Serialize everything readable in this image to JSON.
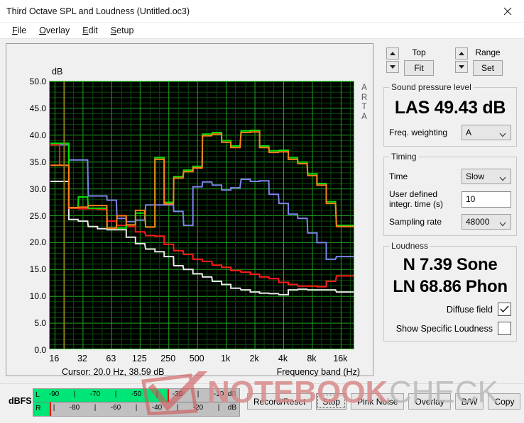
{
  "window": {
    "title": "Third Octave SPL and Loudness (Untitled.oc3)",
    "close_icon": "close-icon"
  },
  "menu": [
    {
      "pre": "F",
      "rest": "ile"
    },
    {
      "pre": "O",
      "rest": "verlay"
    },
    {
      "pre": "E",
      "rest": "dit"
    },
    {
      "pre": "S",
      "rest": "etup"
    }
  ],
  "chart_panel": {
    "title": "Third octave SPL",
    "y_unit": "dB",
    "x_label": "Frequency band (Hz)",
    "cursor": "Cursor:   20.0 Hz, 38.59 dB",
    "watermark_text": "ARTA"
  },
  "controls": {
    "top_label": "Top",
    "top_button": "Fit",
    "range_label": "Range",
    "range_button": "Set",
    "spl_group": "Sound pressure level",
    "spl_value": "LAS 49.43 dB",
    "weighting_label": "Freq. weighting",
    "weighting_value": "A",
    "timing_group": "Timing",
    "time_label": "Time",
    "time_value": "Slow",
    "integr_label_1": "User defined",
    "integr_label_2": "integr. time (s)",
    "integr_value": "10",
    "sampling_label": "Sampling rate",
    "sampling_value": "48000",
    "loudness_group": "Loudness",
    "loudness_sone": "N 7.39 Sone",
    "loudness_phon": "LN 68.86 Phon",
    "diffuse_label": "Diffuse field",
    "diffuse_checked": true,
    "specific_label": "Show Specific Loudness",
    "specific_checked": false
  },
  "meters": {
    "title": "dBFS",
    "left_channel": "L",
    "right_channel": "R",
    "unit": "dB",
    "left_ticks": [
      "-90",
      "-70",
      "-50",
      "-30",
      "-10"
    ],
    "right_ticks": [
      "-80",
      "-60",
      "-40",
      "-20"
    ],
    "left_level_pct": 65,
    "right_level_pct": 8,
    "bar_color": "#00e676",
    "peak_color": "#ff0000"
  },
  "buttons": [
    {
      "label": "Record/Reset",
      "focused": false
    },
    {
      "label": "Stop",
      "focused": true
    },
    {
      "label": "Pink Noise",
      "focused": false
    },
    {
      "label": "Overlay",
      "focused": false
    },
    {
      "label": "B/W",
      "focused": false
    },
    {
      "label": "Copy",
      "focused": false
    }
  ],
  "watermark": {
    "text_bold": "NOTEBOOK",
    "text_light": "CHECK"
  },
  "chart_data": {
    "type": "line",
    "title": "Third octave SPL",
    "xlabel": "Frequency band (Hz)",
    "ylabel": "dB",
    "ylim": [
      0.0,
      50.0
    ],
    "ytick_step": 5.0,
    "yticks": [
      "50.0",
      "45.0",
      "40.0",
      "35.0",
      "30.0",
      "25.0",
      "20.0",
      "15.0",
      "10.0",
      "5.0",
      "0.0"
    ],
    "xticks": [
      "16",
      "32",
      "63",
      "125",
      "250",
      "500",
      "1k",
      "2k",
      "4k",
      "8k",
      "16k"
    ],
    "x_log_scale": true,
    "grid": true,
    "step_plot": true,
    "cursor_freq_hz": 20.0,
    "cursor_db": 38.59,
    "bands_hz": [
      16,
      20,
      25,
      31.5,
      40,
      50,
      63,
      80,
      100,
      125,
      160,
      200,
      250,
      315,
      400,
      500,
      630,
      800,
      1000,
      1250,
      1600,
      2000,
      2500,
      3150,
      4000,
      5000,
      6300,
      8000,
      10000,
      12500,
      16000,
      20000
    ],
    "series": [
      {
        "name": "green",
        "color": "#00e000",
        "values": [
          38.5,
          38.5,
          26.5,
          28.5,
          26.4,
          26.4,
          22.7,
          22.7,
          23.3,
          25.5,
          22.9,
          35.8,
          27.5,
          32.3,
          33.5,
          34.2,
          40.2,
          40.5,
          39.0,
          38.0,
          40.8,
          40.9,
          38.0,
          37.1,
          37.2,
          35.8,
          35.0,
          32.8,
          31.0,
          27.6,
          23.2,
          23.2
        ]
      },
      {
        "name": "orange",
        "color": "#ff7f1a",
        "values": [
          34.4,
          34.4,
          26.5,
          26.6,
          26.9,
          26.9,
          22.7,
          25.0,
          23.3,
          26.0,
          22.9,
          35.5,
          27.2,
          32.0,
          33.2,
          33.9,
          39.9,
          40.2,
          38.7,
          37.7,
          40.5,
          40.6,
          37.7,
          36.8,
          36.9,
          35.5,
          34.7,
          32.5,
          30.7,
          27.3,
          23.0,
          23.0
        ]
      },
      {
        "name": "blue",
        "color": "#7b84ea",
        "values": [
          38.2,
          38.2,
          35.4,
          35.4,
          28.7,
          28.7,
          27.9,
          24.5,
          23.9,
          24.2,
          27.0,
          27.0,
          27.0,
          25.8,
          23.2,
          30.4,
          31.3,
          30.7,
          29.8,
          30.2,
          31.8,
          31.4,
          31.5,
          29.0,
          27.3,
          25.3,
          24.5,
          21.8,
          20.0,
          16.9,
          17.4,
          17.4
        ]
      },
      {
        "name": "red",
        "color": "#ff1a1a",
        "values": [
          38.2,
          34.4,
          26.4,
          26.3,
          26.3,
          26.2,
          24.0,
          23.2,
          23.0,
          22.0,
          21.3,
          21.2,
          19.7,
          18.5,
          17.8,
          16.9,
          16.5,
          15.8,
          15.4,
          14.8,
          14.5,
          14.1,
          13.6,
          13.3,
          12.6,
          12.2,
          11.9,
          11.9,
          11.8,
          12.8,
          13.8,
          13.8
        ]
      },
      {
        "name": "white",
        "color": "#e8e8e8",
        "values": [
          31.4,
          31.4,
          24.3,
          24.0,
          23.0,
          22.6,
          22.4,
          22.4,
          21.0,
          19.8,
          18.8,
          18.3,
          17.4,
          15.7,
          15.0,
          14.2,
          13.6,
          12.8,
          12.2,
          11.5,
          11.2,
          10.8,
          10.6,
          10.5,
          10.3,
          11.2,
          11.3,
          11.2,
          11.2,
          11.2,
          10.8,
          10.8
        ]
      }
    ]
  }
}
